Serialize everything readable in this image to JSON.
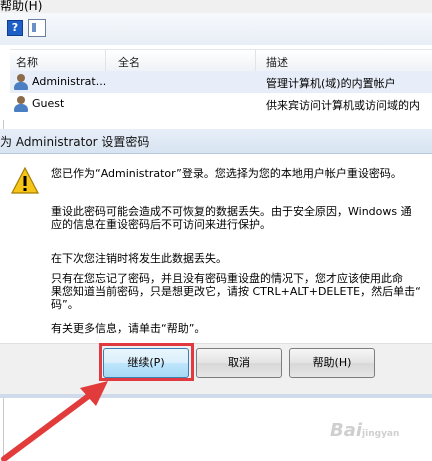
{
  "menu": {
    "partial_label": "帮助(H)"
  },
  "columns": {
    "name": "名称",
    "fullname": "全名",
    "description": "描述"
  },
  "users": [
    {
      "name": "Administrat...",
      "fullname": "",
      "description": "管理计算机(域)的内置帐户"
    },
    {
      "name": "Guest",
      "fullname": "",
      "description": "供来宾访问计算机或访问域的内"
    }
  ],
  "dialog": {
    "title": "为 Administrator 设置密码",
    "paragraph1": "您已作为“Administrator”登录。您选择为您的本地用户帐户重设密码。",
    "paragraph2_line1": "重设此密码可能会造成不可恢复的数据丢失。由于安全原因，Windows 通",
    "paragraph2_line2": "应的信息在重设密码后不可访问来进行保护。",
    "paragraph3": "在下次您注销时将发生此数据丢失。",
    "paragraph4_line1": "只有在您忘记了密码，并且没有密码重设盘的情况下，您才应该使用此命",
    "paragraph4_line2": "果您知道当前密码，只是想更改它，请按 CTRL+ALT+DELETE，然后单击“",
    "paragraph4_line3": "码”。",
    "paragraph5": "有关更多信息，请单击“帮助”。",
    "buttons": {
      "continue": "继续(P)",
      "cancel": "取消",
      "help": "帮助(H)"
    }
  },
  "watermark": {
    "text": "Bai",
    "suffix": "jingyan"
  },
  "colors": {
    "highlight": "#e0393f",
    "arrow": "#e23b3b"
  }
}
